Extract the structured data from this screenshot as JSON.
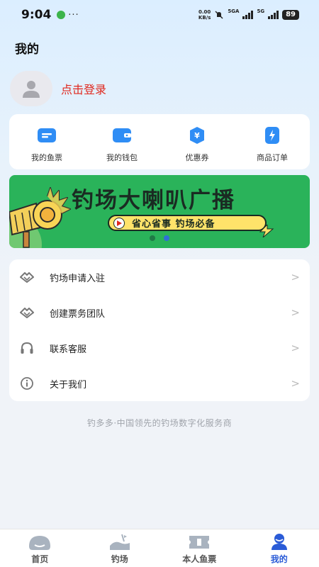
{
  "status_bar": {
    "time": "9:04",
    "more": "···",
    "net_speed_value": "0.00",
    "net_speed_unit": "KB/s",
    "signal_1_label": "5GA",
    "signal_2_label": "5G",
    "battery": "89"
  },
  "page": {
    "title": "我的"
  },
  "profile": {
    "login_text": "点击登录"
  },
  "quick_actions": [
    {
      "label": "我的鱼票",
      "icon": "ticket-icon"
    },
    {
      "label": "我的钱包",
      "icon": "wallet-icon"
    },
    {
      "label": "优惠券",
      "icon": "coupon-icon"
    },
    {
      "label": "商品订单",
      "icon": "order-icon"
    }
  ],
  "banner": {
    "title": "钓场大喇叭广播",
    "subtitle": "省心省事  钓场必备",
    "active_slide": 2,
    "slide_count": 2
  },
  "menu": [
    {
      "label": "钓场申请入驻",
      "icon": "handshake-icon",
      "arrow": ">"
    },
    {
      "label": "创建票务团队",
      "icon": "handshake-icon",
      "arrow": ">"
    },
    {
      "label": "联系客服",
      "icon": "headset-icon",
      "arrow": ">"
    },
    {
      "label": "关于我们",
      "icon": "info-icon",
      "arrow": ">"
    }
  ],
  "slogan": "钓多多·中国领先的钓场数字化服务商",
  "tabbar": [
    {
      "label": "首页",
      "icon": "home-icon",
      "active": false
    },
    {
      "label": "钓场",
      "icon": "fishing-spot-icon",
      "active": false
    },
    {
      "label": "本人鱼票",
      "icon": "my-ticket-icon",
      "active": false
    },
    {
      "label": "我的",
      "icon": "profile-icon",
      "active": true
    }
  ],
  "colors": {
    "accent": "#2a5bd7",
    "login_red": "#e0281e",
    "banner_green": "#2ab35a",
    "icon_blue": "#2f8df5"
  }
}
